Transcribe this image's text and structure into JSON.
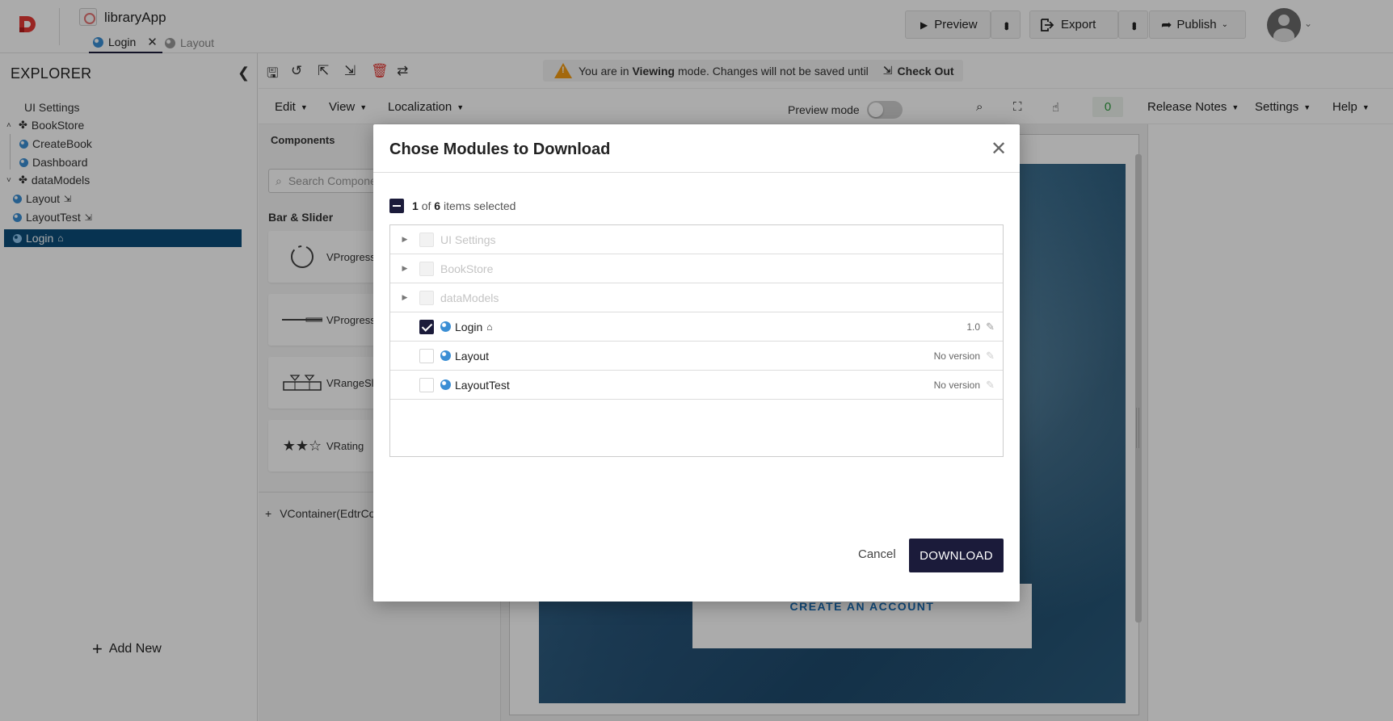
{
  "app": {
    "title": "libraryApp",
    "tabs": [
      {
        "label": "Login",
        "active": true
      },
      {
        "label": "Layout",
        "active": false
      }
    ],
    "buttons": {
      "preview": "Preview",
      "export": "Export",
      "publish": "Publish"
    }
  },
  "explorer": {
    "title": "EXPLORER",
    "items": [
      {
        "label": "UI Settings"
      },
      {
        "label": "BookStore"
      },
      {
        "label": "CreateBook"
      },
      {
        "label": "Dashboard"
      },
      {
        "label": "dataModels"
      },
      {
        "label": "Layout"
      },
      {
        "label": "LayoutTest"
      },
      {
        "label": "Login"
      }
    ],
    "add_new": "Add New"
  },
  "toolbar": {
    "notice_prefix": "You are in",
    "notice_mode": "Viewing",
    "notice_suffix": "mode. Changes will not be saved until",
    "checkout": "Check Out"
  },
  "menubar": {
    "edit": "Edit",
    "view": "View",
    "localization": "Localization",
    "preview_mode": "Preview mode",
    "count": "0",
    "release_notes": "Release Notes",
    "settings": "Settings",
    "help": "Help"
  },
  "components": {
    "title": "Components",
    "search_placeholder": "Search Components",
    "section": "Bar & Slider",
    "cards": [
      "VProgress",
      "VProgress",
      "VRangeSlider",
      "VRating"
    ],
    "container": "VContainer(EdtrCo"
  },
  "canvas": {
    "create_account": "CREATE AN ACCOUNT"
  },
  "modal": {
    "title": "Chose Modules to Download",
    "selected_count": "1",
    "of_label": "of",
    "total_count": "6",
    "items_label": "items selected",
    "rows": [
      {
        "label": "UI Settings",
        "version": ""
      },
      {
        "label": "BookStore",
        "version": ""
      },
      {
        "label": "dataModels",
        "version": ""
      },
      {
        "label": "Login",
        "version": "1.0"
      },
      {
        "label": "Layout",
        "version": "No version"
      },
      {
        "label": "LayoutTest",
        "version": "No version"
      }
    ],
    "cancel": "Cancel",
    "download": "DOWNLOAD"
  },
  "colors": {
    "primary": "#1b1b3a",
    "explorer_selected": "#0b4d79",
    "warning": "#f39c12",
    "count_green": "#2e9c3e"
  }
}
